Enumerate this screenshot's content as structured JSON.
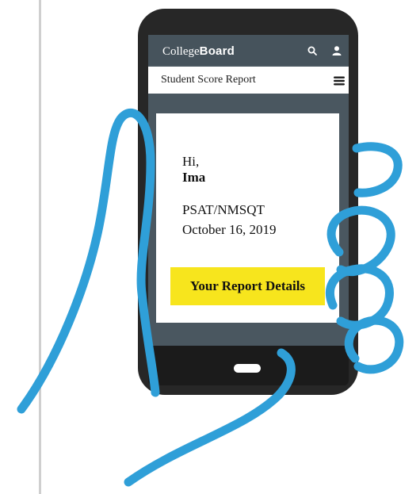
{
  "header": {
    "brand_regular": "College",
    "brand_bold": "Board",
    "search_icon": "search-icon",
    "user_icon": "user-icon"
  },
  "subheader": {
    "title": "Student Score Report",
    "menu_icon": "menu-icon"
  },
  "card": {
    "greeting": "Hi,",
    "student_name": "Ima",
    "test_name": "PSAT/NMSQT",
    "test_date": "October 16, 2019",
    "button_label": "Your Report Details"
  },
  "colors": {
    "phone_body": "#2a2a2a",
    "screen_dark": "#4a5760",
    "button_yellow": "#f7e51d",
    "hand_outline": "#2f9fd8",
    "page_rule": "#cfcfcf"
  }
}
